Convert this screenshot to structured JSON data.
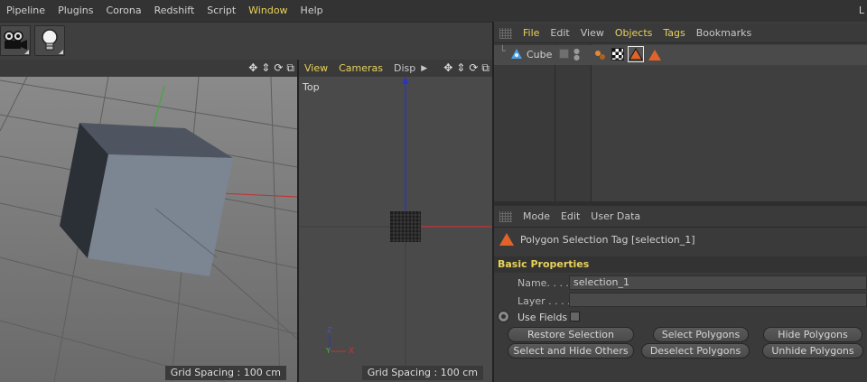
{
  "menubar": {
    "items": [
      "Pipeline",
      "Plugins",
      "Corona",
      "Redshift",
      "Script",
      "Window",
      "Help"
    ],
    "highlighted": "Window",
    "layout_label": "L"
  },
  "toolbar": {
    "buttons": [
      {
        "icon": "camera-icon"
      },
      {
        "icon": "light-bulb-icon"
      }
    ]
  },
  "viewport_perspective": {
    "grid_spacing": "Grid Spacing : 100 cm"
  },
  "viewport_top": {
    "menu": [
      "View",
      "Cameras",
      "Disp"
    ],
    "label": "Top",
    "grid_spacing": "Grid Spacing : 100 cm",
    "axis_z": "Z",
    "axis_y": "Y",
    "axis_x": "X"
  },
  "object_manager": {
    "menu": [
      "File",
      "Edit",
      "View",
      "Objects",
      "Tags",
      "Bookmarks"
    ],
    "highlighted": [
      "File",
      "Objects",
      "Tags"
    ],
    "objects": [
      {
        "name": "Cube",
        "icon": "cube-icon"
      }
    ]
  },
  "attributes": {
    "menu": [
      "Mode",
      "Edit",
      "User Data"
    ],
    "title": "Polygon Selection Tag [selection_1]",
    "section": "Basic Properties",
    "name_label": "Name. . . .",
    "name_value": "selection_1",
    "layer_label": "Layer . . . .",
    "layer_value": "",
    "use_fields_label": "Use Fields",
    "buttons": {
      "restore_selection": "Restore Selection",
      "select_polygons": "Select Polygons",
      "hide_polygons": "Hide Polygons",
      "select_hide_others": "Select and Hide Others",
      "deselect_polygons": "Deselect Polygons",
      "unhide_polygons": "Unhide Polygons"
    }
  },
  "colors": {
    "accent": "#e8d25a",
    "tag_orange": "#e0642a",
    "axis_x": "#d02020",
    "axis_y": "#20c020",
    "axis_z": "#2030c0"
  }
}
